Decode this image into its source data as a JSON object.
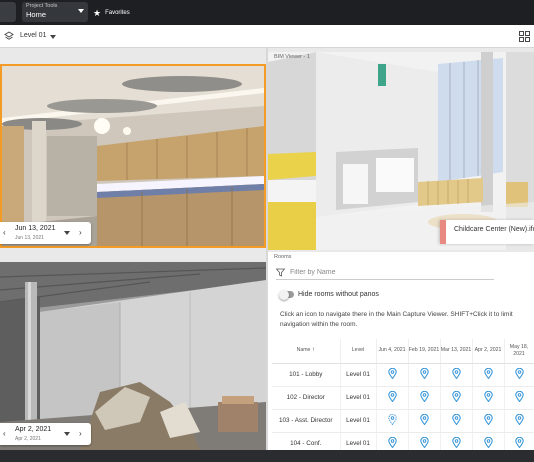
{
  "topbar": {
    "project_caption": "Project Tools",
    "project_value": "Home",
    "favorites_icon": "star-icon",
    "favorites_label": "Favorites"
  },
  "levelbar": {
    "layers_icon": "layers-icon",
    "level": "Level 01",
    "grid_icon": "grid-view-icon"
  },
  "capture_top": {
    "date": "Jun 13, 2021",
    "sub_date": "Jun 13, 2021"
  },
  "capture_bottom": {
    "date": "Apr 2, 2021",
    "sub_date": "Apr 2, 2021"
  },
  "bim": {
    "title": "BIM Viewer - 1",
    "tooltip": "Childcare Center (New).ifc"
  },
  "rooms": {
    "title": "Rooms",
    "filter_placeholder": "Filter by Name",
    "toggle_label": "Hide rooms without panos",
    "help_text": "Click an icon to navigate there in the Main Capture Viewer. SHIFT+Click it to limit navigation within the room.",
    "columns": [
      "Name",
      "Level",
      "Jun 4, 2021",
      "Feb 19, 2021",
      "Mar 13, 2021",
      "Apr 2, 2021",
      "May 18, 2021"
    ],
    "rows": [
      {
        "name": "101 - Lobby",
        "level": "Level 01",
        "pins": [
          "pin",
          "pin",
          "pin",
          "pin",
          "pin"
        ]
      },
      {
        "name": "102 - Director",
        "level": "Level 01",
        "pins": [
          "pin",
          "pin",
          "pin",
          "pin",
          "pin"
        ]
      },
      {
        "name": "103 - Asst. Director",
        "level": "Level 01",
        "pins": [
          "pin-dashed",
          "pin",
          "pin",
          "pin",
          "pin"
        ]
      },
      {
        "name": "104 - Conf.",
        "level": "Level 01",
        "pins": [
          "pin",
          "pin",
          "pin",
          "pin",
          "pin"
        ]
      }
    ]
  },
  "colors": {
    "accent_orange": "#f29b27",
    "pin_blue": "#2b8fd6",
    "tooltip_accent": "#e88a82"
  }
}
